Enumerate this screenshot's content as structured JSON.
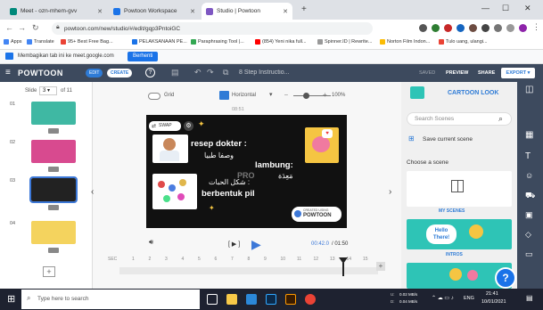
{
  "browser": {
    "tabs": [
      {
        "label": "Meet - ozn-mhem-gvv",
        "color": "#00897b"
      },
      {
        "label": "Powtoon Workspace",
        "color": "#1a73e8"
      },
      {
        "label": "Studio | Powtoon",
        "color": "#7e57c2"
      }
    ],
    "new_tab": "+",
    "url": "powtoon.com/new/studio/#/edit/gqp3PntoiGC",
    "bookmarks": [
      {
        "label": "Apps",
        "color": "#4285f4"
      },
      {
        "label": "Translate",
        "color": "#4285f4"
      },
      {
        "label": "95+ Best Free Bag...",
        "color": "#ea4335"
      },
      {
        "label": "PELAKSANAAN PE...",
        "color": "#1a73e8"
      },
      {
        "label": "Paraphrasing Tool |...",
        "color": "#34a853"
      },
      {
        "label": "(854) Yeni nika full...",
        "color": "#ff0000"
      },
      {
        "label": "Spinner.ID | Rewrite...",
        "color": "#999999"
      },
      {
        "label": "Norton Film Indon...",
        "color": "#fbbc04"
      },
      {
        "label": "Tulo uang, ulangi...",
        "color": "#ea4335"
      }
    ]
  },
  "share_banner": {
    "text": "Membagikan tab ini ke meet.google.com",
    "button": "Berhenti"
  },
  "powtoon": {
    "logo": "POWTOON",
    "badges": [
      "EDIT",
      "CREATE"
    ],
    "help": "?",
    "title": "8 Step Instructio...",
    "actions": [
      "SAVED",
      "PREVIEW",
      "SHARE"
    ],
    "export": "EXPORT"
  },
  "sidebar": {
    "slide_label": "Slide",
    "slide_num": "3",
    "of_total": "of 11",
    "slides": [
      {
        "num": "01",
        "color": "#3fb8a3"
      },
      {
        "num": "02",
        "color": "#d84a8f"
      },
      {
        "num": "03",
        "color": "#222222"
      },
      {
        "num": "04",
        "color": "#f4d35e"
      }
    ]
  },
  "toolbar": {
    "grid": "Grid",
    "orientation": "Horizontal",
    "zoom": "100%",
    "time_marker": "08:51"
  },
  "stage": {
    "swap": "SWAP",
    "line1": "resep dokter :",
    "line2": "وصفا طبيا",
    "line3": "lambung:",
    "line4": "مَعِدَة",
    "line5": "شكل الحبات :",
    "line6": "berbentuk pil",
    "pro": "PRO",
    "watermark_small": "CREATED USING",
    "watermark": "POWTOON"
  },
  "playback": {
    "ctrl": "[ ▶ ]",
    "time": "00:42.0",
    "total": "/ 01:50"
  },
  "timeline": {
    "label": "SEC",
    "ticks": [
      "1",
      "2",
      "3",
      "4",
      "5",
      "6",
      "7",
      "8",
      "9",
      "10",
      "11",
      "12",
      "13",
      "14",
      "15"
    ]
  },
  "right_panel": {
    "title": "CARTOON LOOK",
    "search_placeholder": "Search Scenes",
    "save_scene": "Save current scene",
    "choose": "Choose a scene",
    "my_scenes": "MY SCENES",
    "intros": "INTROS",
    "hello": "Hello There!"
  },
  "taskbar": {
    "search": "Type here to search",
    "net_up": "0.02 MB/s",
    "net_down": "0.04 MB/s",
    "lang": "ENG",
    "time": "21:41",
    "date": "10/01/2021",
    "icons": [
      {
        "name": "task-view-icon",
        "color": "#ffffff"
      },
      {
        "name": "file-explorer-icon",
        "color": "#f7c948"
      },
      {
        "name": "store-icon",
        "color": "#2b88d8"
      },
      {
        "name": "photoshop-icon",
        "color": "#31a8ff"
      },
      {
        "name": "illustrator-icon",
        "color": "#ff9a00"
      },
      {
        "name": "chrome-icon",
        "color": "#ea4335"
      }
    ]
  },
  "colors": {
    "powtoon_dark": "#3d4a5e",
    "accent_blue": "#3c78d8",
    "teal": "#2ec4b6",
    "playhead_red": "#e33"
  }
}
